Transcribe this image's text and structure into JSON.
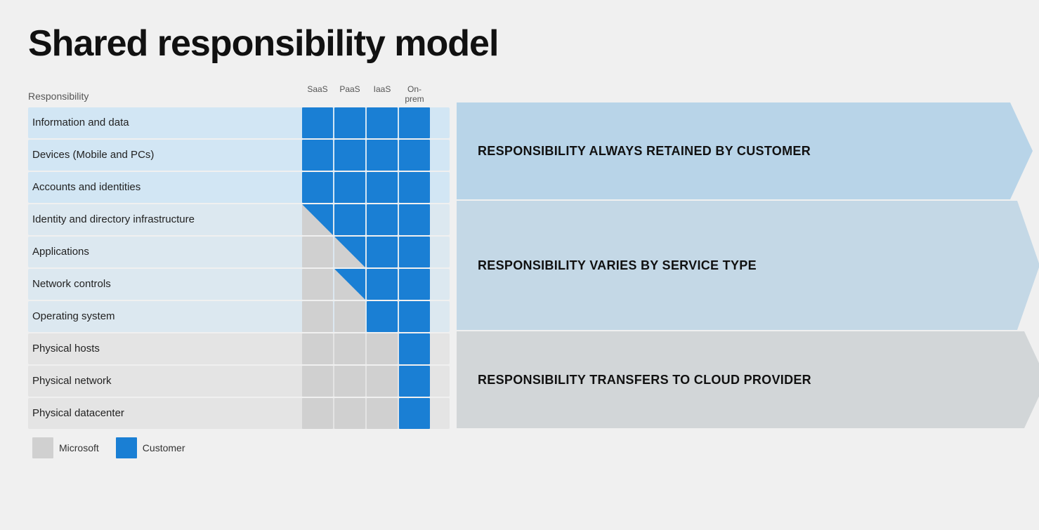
{
  "title": "Shared responsibility model",
  "table": {
    "responsibility_header": "Responsibility",
    "columns": [
      {
        "label": "SaaS"
      },
      {
        "label": "PaaS"
      },
      {
        "label": "IaaS"
      },
      {
        "label": "On-\nprem"
      }
    ],
    "rows": [
      {
        "label": "Information and data",
        "group": "always",
        "cells": [
          "blue",
          "blue",
          "blue",
          "blue"
        ]
      },
      {
        "label": "Devices (Mobile and PCs)",
        "group": "always",
        "cells": [
          "blue",
          "blue",
          "blue",
          "blue"
        ]
      },
      {
        "label": "Accounts and identities",
        "group": "always",
        "cells": [
          "blue",
          "blue",
          "blue",
          "blue"
        ]
      },
      {
        "label": "Identity and directory infrastructure",
        "group": "varies",
        "cells": [
          "diag",
          "blue",
          "blue",
          "blue"
        ]
      },
      {
        "label": "Applications",
        "group": "varies",
        "cells": [
          "gray",
          "diag",
          "blue",
          "blue"
        ]
      },
      {
        "label": "Network controls",
        "group": "varies",
        "cells": [
          "gray",
          "diag",
          "blue",
          "blue"
        ]
      },
      {
        "label": "Operating system",
        "group": "varies",
        "cells": [
          "gray",
          "gray",
          "blue",
          "blue"
        ]
      },
      {
        "label": "Physical hosts",
        "group": "transfers",
        "cells": [
          "gray",
          "gray",
          "gray",
          "blue"
        ]
      },
      {
        "label": "Physical network",
        "group": "transfers",
        "cells": [
          "gray",
          "gray",
          "gray",
          "blue"
        ]
      },
      {
        "label": "Physical datacenter",
        "group": "transfers",
        "cells": [
          "gray",
          "gray",
          "gray",
          "blue"
        ]
      }
    ]
  },
  "arrows": [
    {
      "id": "always",
      "text": "RESPONSIBILITY ALWAYS RETAINED BY CUSTOMER",
      "rows_count": 3
    },
    {
      "id": "varies",
      "text": "RESPONSIBILITY VARIES BY SERVICE TYPE",
      "rows_count": 4
    },
    {
      "id": "transfers",
      "text": "RESPONSIBILITY TRANSFERS TO CLOUD PROVIDER",
      "rows_count": 3
    }
  ],
  "legend": {
    "items": [
      {
        "label": "Microsoft",
        "color": "#d0d0d0"
      },
      {
        "label": "Customer",
        "color": "#1a7fd4"
      }
    ]
  }
}
